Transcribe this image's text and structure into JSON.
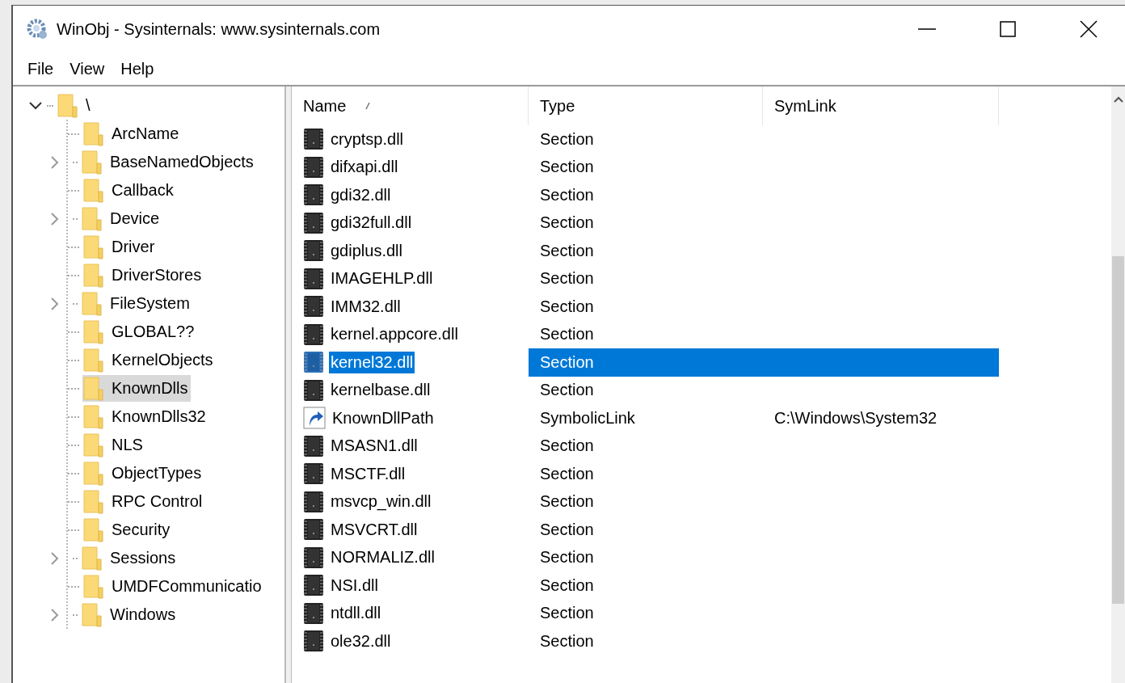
{
  "window": {
    "title": "WinObj - Sysinternals: www.sysinternals.com"
  },
  "menu": [
    "File",
    "View",
    "Help"
  ],
  "tree": {
    "label": "\\",
    "expanded": true,
    "selected": false,
    "children": [
      {
        "label": "ArcName",
        "has_children": false,
        "selected": false
      },
      {
        "label": "BaseNamedObjects",
        "has_children": true,
        "selected": false
      },
      {
        "label": "Callback",
        "has_children": false,
        "selected": false
      },
      {
        "label": "Device",
        "has_children": true,
        "selected": false
      },
      {
        "label": "Driver",
        "has_children": false,
        "selected": false
      },
      {
        "label": "DriverStores",
        "has_children": false,
        "selected": false
      },
      {
        "label": "FileSystem",
        "has_children": true,
        "selected": false
      },
      {
        "label": "GLOBAL??",
        "has_children": false,
        "selected": false
      },
      {
        "label": "KernelObjects",
        "has_children": false,
        "selected": false
      },
      {
        "label": "KnownDlls",
        "has_children": false,
        "selected": true
      },
      {
        "label": "KnownDlls32",
        "has_children": false,
        "selected": false
      },
      {
        "label": "NLS",
        "has_children": false,
        "selected": false
      },
      {
        "label": "ObjectTypes",
        "has_children": false,
        "selected": false
      },
      {
        "label": "RPC Control",
        "has_children": false,
        "selected": false
      },
      {
        "label": "Security",
        "has_children": false,
        "selected": false
      },
      {
        "label": "Sessions",
        "has_children": true,
        "selected": false
      },
      {
        "label": "UMDFCommunicatio",
        "has_children": false,
        "selected": false
      },
      {
        "label": "Windows",
        "has_children": true,
        "selected": false
      }
    ]
  },
  "table": {
    "columns": [
      {
        "label": "Name",
        "sorted": true
      },
      {
        "label": "Type",
        "sorted": false
      },
      {
        "label": "SymLink",
        "sorted": false
      }
    ],
    "rows": [
      {
        "kind": "section",
        "name": "cryptsp.dll",
        "type": "Section",
        "selected": false
      },
      {
        "kind": "section",
        "name": "difxapi.dll",
        "type": "Section",
        "selected": false
      },
      {
        "kind": "section",
        "name": "gdi32.dll",
        "type": "Section",
        "selected": false
      },
      {
        "kind": "section",
        "name": "gdi32full.dll",
        "type": "Section",
        "selected": false
      },
      {
        "kind": "section",
        "name": "gdiplus.dll",
        "type": "Section",
        "selected": false
      },
      {
        "kind": "section",
        "name": "IMAGEHLP.dll",
        "type": "Section",
        "selected": false
      },
      {
        "kind": "section",
        "name": "IMM32.dll",
        "type": "Section",
        "selected": false
      },
      {
        "kind": "section",
        "name": "kernel.appcore.dll",
        "type": "Section",
        "selected": false
      },
      {
        "kind": "section",
        "name": "kernel32.dll",
        "type": "Section",
        "selected": true
      },
      {
        "kind": "section",
        "name": "kernelbase.dll",
        "type": "Section",
        "selected": false
      },
      {
        "kind": "symlink",
        "name": "KnownDllPath",
        "type": "SymbolicLink",
        "symlink": "C:\\Windows\\System32",
        "selected": false
      },
      {
        "kind": "section",
        "name": "MSASN1.dll",
        "type": "Section",
        "selected": false
      },
      {
        "kind": "section",
        "name": "MSCTF.dll",
        "type": "Section",
        "selected": false
      },
      {
        "kind": "section",
        "name": "msvcp_win.dll",
        "type": "Section",
        "selected": false
      },
      {
        "kind": "section",
        "name": "MSVCRT.dll",
        "type": "Section",
        "selected": false
      },
      {
        "kind": "section",
        "name": "NORMALIZ.dll",
        "type": "Section",
        "selected": false
      },
      {
        "kind": "section",
        "name": "NSI.dll",
        "type": "Section",
        "selected": false
      },
      {
        "kind": "section",
        "name": "ntdll.dll",
        "type": "Section",
        "selected": false
      },
      {
        "kind": "section",
        "name": "ole32.dll",
        "type": "Section",
        "selected": false
      }
    ]
  }
}
